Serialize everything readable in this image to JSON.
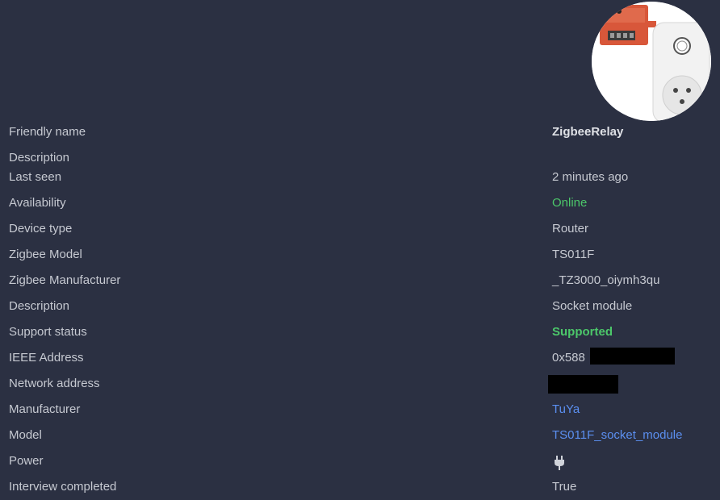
{
  "device": {
    "image_alt": "TS011F socket module"
  },
  "rows": [
    {
      "label": "Friendly name",
      "value": "ZigbeeRelay"
    },
    {
      "label": "Description",
      "value": ""
    },
    {
      "label": "Last seen",
      "value": "2 minutes ago"
    },
    {
      "label": "Availability",
      "value": "Online"
    },
    {
      "label": "Device type",
      "value": "Router"
    },
    {
      "label": "Zigbee Model",
      "value": "TS011F"
    },
    {
      "label": "Zigbee Manufacturer",
      "value": "_TZ3000_oiymh3qu"
    },
    {
      "label": "Description",
      "value": "Socket module"
    },
    {
      "label": "Support status",
      "value": "Supported"
    },
    {
      "label": "IEEE Address",
      "value": "0x588"
    },
    {
      "label": "Network address",
      "value": ""
    },
    {
      "label": "Manufacturer",
      "value": "TuYa"
    },
    {
      "label": "Model",
      "value": "TS011F_socket_module"
    },
    {
      "label": "Power",
      "value": "",
      "icon": "plug-icon"
    },
    {
      "label": "Interview completed",
      "value": "True"
    }
  ],
  "colors": {
    "background": "#2b3042",
    "text": "#c6c9d1",
    "online": "#4cc76a",
    "link": "#5b8ff0"
  }
}
